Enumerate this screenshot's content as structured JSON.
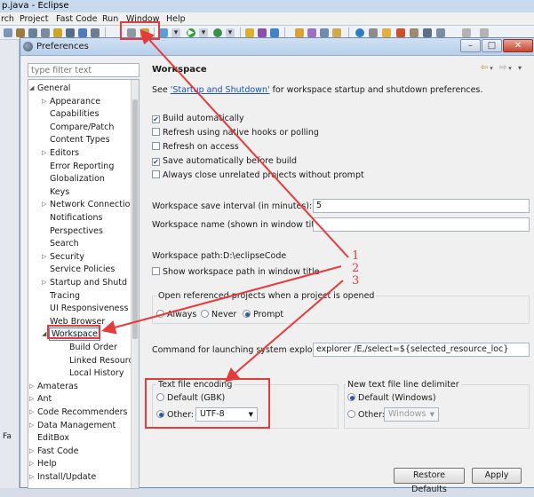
{
  "eclipse": {
    "title": "p.java - Eclipse",
    "menu": [
      "rch",
      "Project",
      "Fast Code",
      "Run",
      "Window",
      "Help"
    ],
    "side_label": "Fa"
  },
  "dialog": {
    "title": "Preferences",
    "filter_placeholder": "type filter text",
    "tree": [
      {
        "label": "General",
        "arrow": "expanded",
        "level": 0
      },
      {
        "label": "Appearance",
        "arrow": "collapsed",
        "level": 1
      },
      {
        "label": "Capabilities",
        "arrow": "",
        "level": 1
      },
      {
        "label": "Compare/Patch",
        "arrow": "",
        "level": 1
      },
      {
        "label": "Content Types",
        "arrow": "",
        "level": 1
      },
      {
        "label": "Editors",
        "arrow": "collapsed",
        "level": 1
      },
      {
        "label": "Error Reporting",
        "arrow": "",
        "level": 1
      },
      {
        "label": "Globalization",
        "arrow": "",
        "level": 1
      },
      {
        "label": "Keys",
        "arrow": "",
        "level": 1
      },
      {
        "label": "Network Connectio",
        "arrow": "collapsed",
        "level": 1
      },
      {
        "label": "Notifications",
        "arrow": "",
        "level": 1
      },
      {
        "label": "Perspectives",
        "arrow": "",
        "level": 1
      },
      {
        "label": "Search",
        "arrow": "",
        "level": 1
      },
      {
        "label": "Security",
        "arrow": "collapsed",
        "level": 1
      },
      {
        "label": "Service Policies",
        "arrow": "",
        "level": 1
      },
      {
        "label": "Startup and Shutd",
        "arrow": "collapsed",
        "level": 1
      },
      {
        "label": "Tracing",
        "arrow": "",
        "level": 1
      },
      {
        "label": "UI Responsiveness",
        "arrow": "",
        "level": 1
      },
      {
        "label": "Web Browser",
        "arrow": "",
        "level": 1
      },
      {
        "label": "Workspace",
        "arrow": "expanded",
        "level": 1,
        "selected": true
      },
      {
        "label": "Build Order",
        "arrow": "",
        "level": 2
      },
      {
        "label": "Linked Resourc",
        "arrow": "",
        "level": 2
      },
      {
        "label": "Local History",
        "arrow": "",
        "level": 2
      },
      {
        "label": "Amateras",
        "arrow": "collapsed",
        "level": 0
      },
      {
        "label": "Ant",
        "arrow": "collapsed",
        "level": 0
      },
      {
        "label": "Code Recommenders",
        "arrow": "collapsed",
        "level": 0
      },
      {
        "label": "Data Management",
        "arrow": "collapsed",
        "level": 0
      },
      {
        "label": "EditBox",
        "arrow": "",
        "level": 0
      },
      {
        "label": "Fast Code",
        "arrow": "collapsed",
        "level": 0
      },
      {
        "label": "Help",
        "arrow": "collapsed",
        "level": 0
      },
      {
        "label": "Install/Update",
        "arrow": "collapsed",
        "level": 0
      }
    ]
  },
  "page": {
    "title": "Workspace",
    "intro_prefix": "See ",
    "intro_link": "'Startup and Shutdown'",
    "intro_suffix": " for workspace startup and shutdown preferences.",
    "checkboxes": [
      {
        "label": "Build automatically",
        "checked": true
      },
      {
        "label": "Refresh using native hooks or polling",
        "checked": false
      },
      {
        "label": "Refresh on access",
        "checked": false
      },
      {
        "label": "Save automatically before build",
        "checked": true
      },
      {
        "label": "Always close unrelated projects without prompt",
        "checked": false
      }
    ],
    "save_interval_label": "Workspace save interval (in minutes):",
    "save_interval_value": "5",
    "workspace_name_label": "Workspace name (shown in window title):",
    "workspace_name_value": "",
    "workspace_path_label": "Workspace path:",
    "workspace_path_value": "D:\\eclipseCode",
    "show_path_label": "Show workspace path in window title",
    "open_projects_title": "Open referenced projects when a project is opened",
    "open_projects_options": [
      "Always",
      "Never",
      "Prompt"
    ],
    "open_projects_selected": "Prompt",
    "explorer_label": "Command for launching system explorer:",
    "explorer_value": "explorer /E,/select=${selected_resource_loc}",
    "encoding_title": "Text file encoding",
    "encoding_default": "Default (GBK)",
    "encoding_other": "Other:",
    "encoding_value": "UTF-8",
    "delimiter_title": "New text file line delimiter",
    "delimiter_default": "Default (Windows)",
    "delimiter_other": "Other:",
    "delimiter_value": "Windows",
    "restore_defaults": "Restore Defaults",
    "apply": "Apply"
  },
  "annotations": {
    "labels": [
      "1",
      "2",
      "3"
    ],
    "color": "#e53b3b"
  }
}
